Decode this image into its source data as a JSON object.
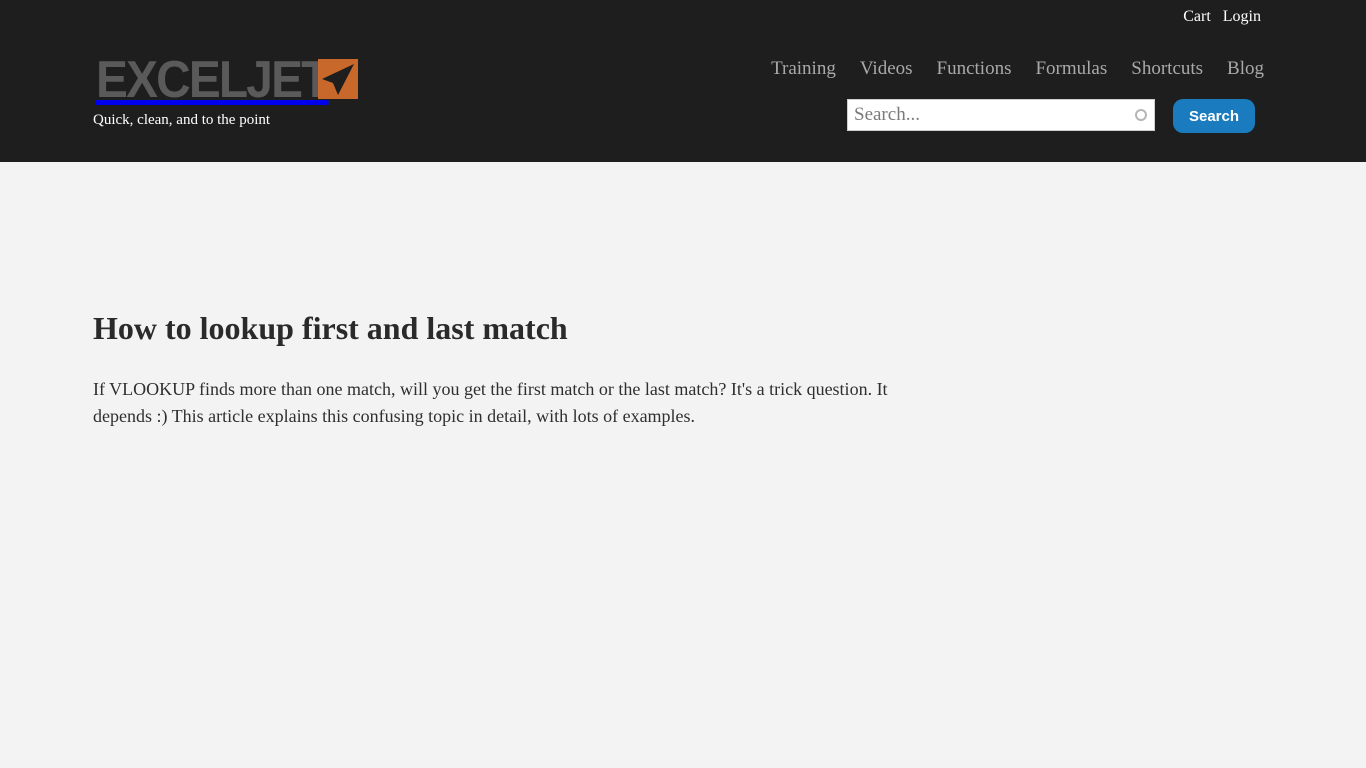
{
  "header": {
    "top_links": {
      "cart": "Cart",
      "login": "Login"
    },
    "logo": {
      "text": "EXCELJET",
      "icon": "exceljet-arrow-icon",
      "accent": "#c8682a"
    },
    "tagline": "Quick, clean, and to the point",
    "nav": [
      "Training",
      "Videos",
      "Functions",
      "Formulas",
      "Shortcuts",
      "Blog"
    ],
    "search": {
      "placeholder": "Search...",
      "button_label": "Search",
      "button_color": "#1a7bbf"
    }
  },
  "main": {
    "title": "How to lookup first and last match",
    "description": "If VLOOKUP finds more than one match, will you get the first match or the last match? It's a trick question. It depends :) This article explains this confusing topic in detail, with lots of examples."
  }
}
